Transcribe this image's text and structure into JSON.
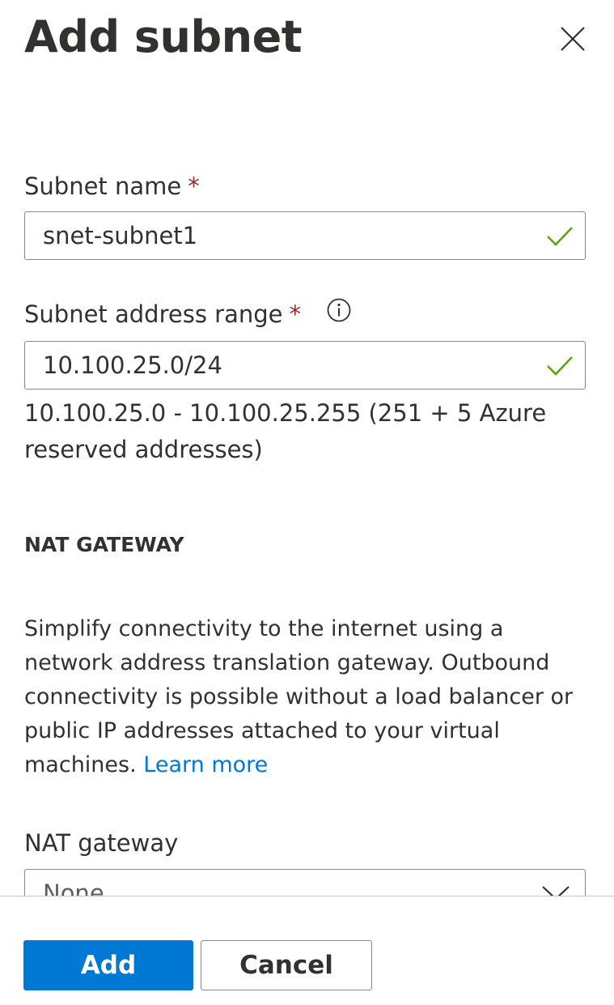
{
  "panel": {
    "title": "Add subnet"
  },
  "subnet_name": {
    "label": "Subnet name",
    "required_mark": "*",
    "value": "snet-subnet1"
  },
  "address_range": {
    "label": "Subnet address range",
    "required_mark": "*",
    "value": "10.100.25.0/24",
    "hint": "10.100.25.0 - 10.100.25.255 (251 + 5 Azure reserved addresses)"
  },
  "nat_section": {
    "heading": "NAT GATEWAY",
    "description": "Simplify connectivity to the internet using a network address translation gateway. Outbound connectivity is possible without a load balancer or public IP addresses attached to your virtual machines.",
    "learn_more": "Learn more"
  },
  "nat_gateway": {
    "label": "NAT gateway",
    "selected": "None"
  },
  "footer": {
    "add_label": "Add",
    "cancel_label": "Cancel"
  },
  "colors": {
    "primary": "#0078d4",
    "required": "#a4262c",
    "valid_check": "#57a300",
    "text": "#323130",
    "border": "#8a8886"
  },
  "icons": {
    "close": "close-icon",
    "info": "info-icon",
    "valid": "checkmark-icon",
    "dropdown": "chevron-down-icon"
  }
}
